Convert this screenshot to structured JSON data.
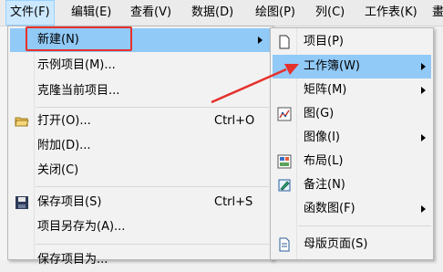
{
  "menubar": {
    "items": [
      {
        "label": "文件(F)"
      },
      {
        "label": "编辑(E)"
      },
      {
        "label": "查看(V)"
      },
      {
        "label": "数据(D)"
      },
      {
        "label": "绘图(P)"
      },
      {
        "label": "列(C)"
      },
      {
        "label": "工作表(K)"
      },
      {
        "label": "畫"
      }
    ]
  },
  "file_menu": {
    "items": [
      {
        "label": "新建(N)",
        "has_submenu": true,
        "highlighted": true
      },
      {
        "label": "示例项目(M)..."
      },
      {
        "label": "克隆当前项目..."
      },
      {
        "label": "打开(O)...",
        "shortcut": "Ctrl+O",
        "icon": "open-folder-icon"
      },
      {
        "label": "附加(D)..."
      },
      {
        "label": "关闭(C)"
      },
      {
        "label": "保存项目(S)",
        "shortcut": "Ctrl+S",
        "icon": "save-disk-icon"
      },
      {
        "label": "项目另存为(A)..."
      },
      {
        "label": "保存项目为..."
      }
    ]
  },
  "new_submenu": {
    "items": [
      {
        "label": "项目(P)",
        "icon": "blank-page-icon"
      },
      {
        "label": "工作簿(W)",
        "has_submenu": true,
        "highlighted": true
      },
      {
        "label": "矩阵(M)",
        "has_submenu": true
      },
      {
        "label": "图(G)",
        "icon": "graph-icon"
      },
      {
        "label": "图像(I)",
        "has_submenu": true
      },
      {
        "label": "布局(L)",
        "icon": "layout-icon"
      },
      {
        "label": "备注(N)",
        "icon": "notes-icon"
      },
      {
        "label": "函数图(F)",
        "has_submenu": true
      },
      {
        "label": "母版页面(S)",
        "icon": "master-page-icon"
      }
    ]
  },
  "annotation": {
    "highlight_color": "#e5312c"
  }
}
